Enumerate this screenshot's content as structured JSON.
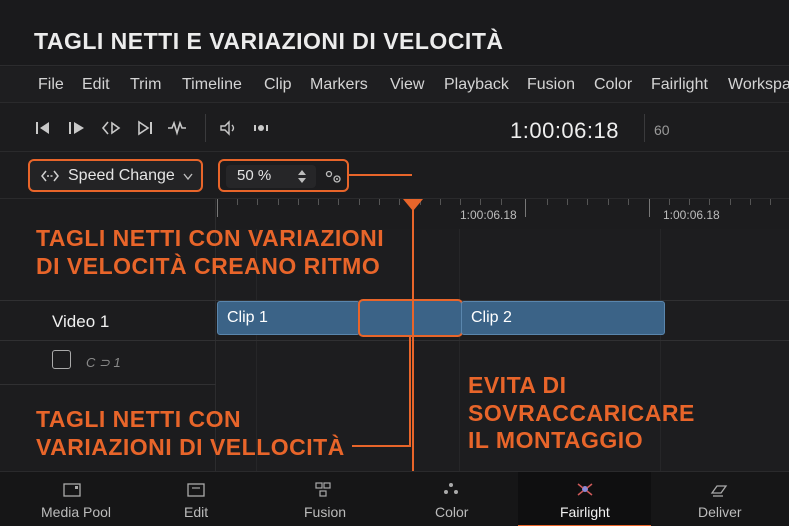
{
  "title": "TAGLI NETTI E VARIAZIONI DI VELOCITÀ",
  "menu": [
    "File",
    "Edit",
    "Trim",
    "Timeline",
    "Clip",
    "Markers",
    "View",
    "Playback",
    "Fusion",
    "Color",
    "Fairlight",
    "Workspa"
  ],
  "transport": {
    "timecode": "1:00:06:18",
    "fps": "60",
    "icons": [
      "go-to-start-icon",
      "play-pause-icon",
      "step-frame-icon",
      "go-to-end-icon",
      "snap-icon",
      "audio-volume-icon",
      "audio-scrub-icon"
    ]
  },
  "speed_control": {
    "mode_label": "Speed Change",
    "percent_value": "50 %"
  },
  "ruler": {
    "timecodes": [
      "1:00:06.18",
      "1:00:06.18"
    ]
  },
  "tracks": {
    "video_label": "Video 1",
    "audio_label": "C ⊃ 1"
  },
  "clips": [
    "Clip 1",
    "Clip 2"
  ],
  "callouts": {
    "top": [
      "TAGLI NETTI CON VARIAZIONI",
      "DI VELOCITÀ CREANO RITMO"
    ],
    "bottom_left": [
      "TAGLI NETTI CON",
      "VARIAZIONI DI VELLOCITÀ"
    ],
    "bottom_right": [
      "EVITA DI",
      "SOVRACCARICARE",
      "IL MONTAGGIO"
    ]
  },
  "pages": [
    {
      "label": "Media Pool",
      "icon": "media-pool-icon",
      "active": false
    },
    {
      "label": "Edit",
      "icon": "edit-icon",
      "active": false
    },
    {
      "label": "Fusion",
      "icon": "fusion-icon",
      "active": false
    },
    {
      "label": "Color",
      "icon": "color-icon",
      "active": false
    },
    {
      "label": "Fairlight",
      "icon": "fairlight-icon",
      "active": true
    },
    {
      "label": "Deliver",
      "icon": "deliver-icon",
      "active": false
    }
  ],
  "colors": {
    "accent": "#e8652a",
    "clip": "#3b6387",
    "background": "#1c1c1e"
  }
}
